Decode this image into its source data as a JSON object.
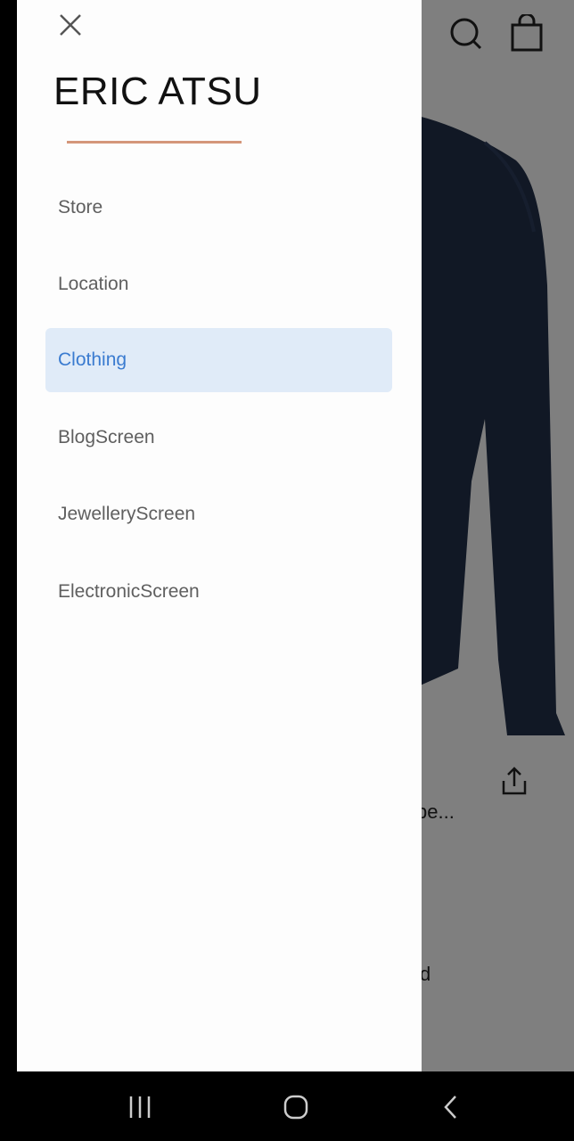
{
  "drawer": {
    "title": "ERIC ATSU",
    "accent_color": "#d4967a",
    "close_icon": "close-icon",
    "items": [
      {
        "label": "Store",
        "active": false
      },
      {
        "label": "Location",
        "active": false
      },
      {
        "label": "Clothing",
        "active": true
      },
      {
        "label": "BlogScreen",
        "active": false
      },
      {
        "label": "JewelleryScreen",
        "active": false
      },
      {
        "label": "ElectronicScreen",
        "active": false
      }
    ]
  },
  "background": {
    "snippet_1": "pe...",
    "snippet_2": "d",
    "icons": [
      "search-icon",
      "shopping-bag-icon",
      "share-icon"
    ]
  },
  "system_nav": {
    "icons": [
      "recent-apps-icon",
      "home-icon",
      "back-icon"
    ]
  },
  "colors": {
    "active_bg": "#e0ebf8",
    "active_text": "#3a7bd0"
  }
}
